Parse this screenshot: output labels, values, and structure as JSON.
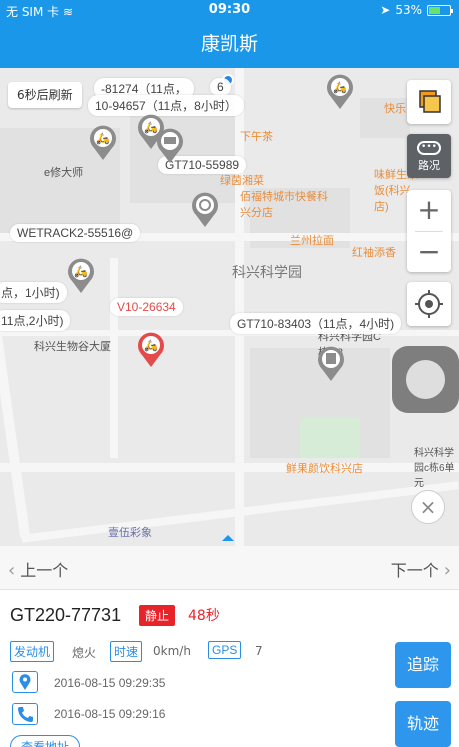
{
  "status_bar": {
    "carrier": "无 SIM 卡",
    "time": "09:30",
    "battery": "53%",
    "battery_level": 0.53
  },
  "nav": {
    "title": "康凯斯"
  },
  "map": {
    "refresh_label": "6秒后刷新",
    "traffic_label": "路况",
    "zoom_in": "+",
    "zoom_out": "−",
    "close_symbol": "×",
    "area_name": "科兴科学园",
    "pois": [
      "e修大师",
      "下午茶",
      "绿茵湘菜",
      "佰福特城市快餐科兴分店",
      "兰州拉面",
      "红袖添香",
      "味鲜生米饭(科兴店)",
      "快乐的",
      "科兴生物谷大厦",
      "科兴科学园C栋C3",
      "鲜果颜饮科兴店",
      "科兴科学园c栋6单元",
      "壹伍彩象"
    ],
    "vehicle_labels": [
      "-81274（11点，",
      "10-94657（11点，8小时）",
      "GT710-55989",
      "WETRACK2-55516@",
      "点，1小时)",
      "11点,2小时)",
      "V10-26634",
      "GT710-83403（11点，4小时)",
      "6"
    ]
  },
  "pager": {
    "prev_label": "上一个",
    "next_label": "下一个"
  },
  "vehicle": {
    "plate": "GT220-77731",
    "state": "静止",
    "state_duration": "48秒",
    "engine_tag": "发动机",
    "engine_value": "熄火",
    "speed_tag": "时速",
    "speed_value": "0km/h",
    "gps_tag": "GPS",
    "gps_value": "7",
    "location_time": "2016-08-15 09:29:35",
    "comm_time": "2016-08-15 09:29:16",
    "address_button": "查看地址",
    "track_button": "追踪",
    "trail_button": "轨迹"
  },
  "colors": {
    "primary": "#1a97e8",
    "button": "#2e96ec",
    "alert_red": "#e8242b",
    "poi_orange": "#e98d3a"
  }
}
